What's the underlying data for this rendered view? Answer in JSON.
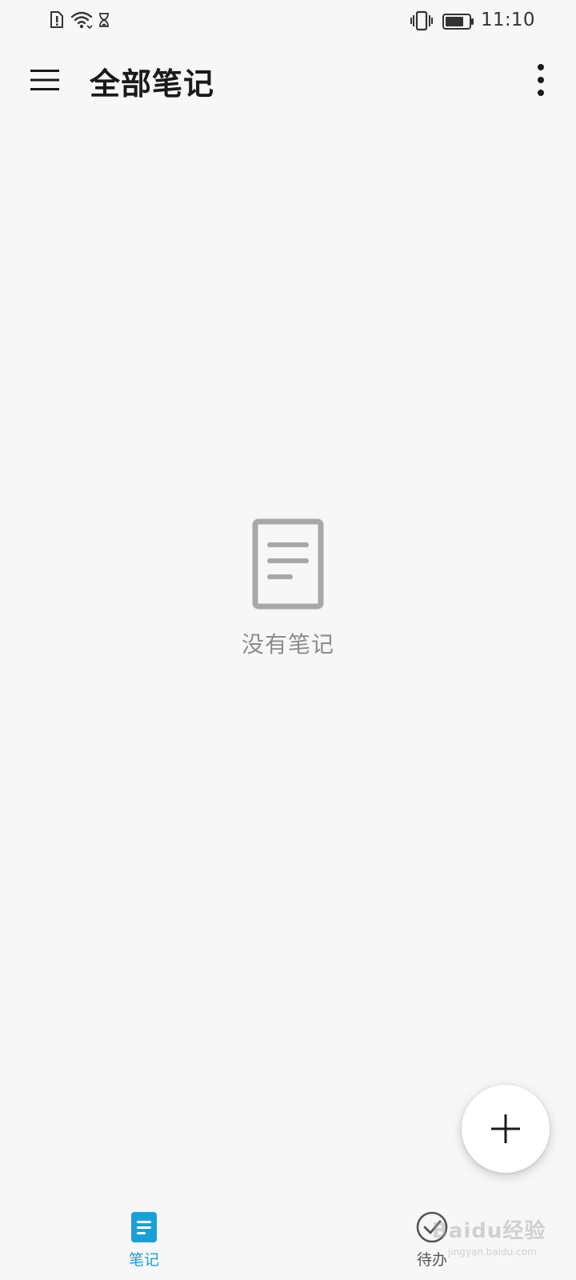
{
  "status_bar": {
    "time": "11:10",
    "icons": [
      "sim-alert-icon",
      "wifi-icon",
      "hourglass-icon",
      "vibrate-icon",
      "battery-icon"
    ]
  },
  "app_bar": {
    "title": "全部笔记",
    "menu_icon": "hamburger-menu-icon",
    "more_icon": "more-vertical-icon"
  },
  "empty_state": {
    "icon": "note-document-icon",
    "text": "没有笔记"
  },
  "fab": {
    "icon": "plus-icon"
  },
  "bottom_nav": {
    "items": [
      {
        "label": "笔记",
        "icon": "note-icon",
        "active": true
      },
      {
        "label": "待办",
        "icon": "check-circle-icon",
        "active": false
      }
    ]
  },
  "colors": {
    "background": "#f7f7f7",
    "accent": "#1a9fd9",
    "empty_icon": "#a8a8a8"
  },
  "watermark": {
    "logo": "Baidu经验",
    "sub": "jingyan.baidu.com"
  }
}
